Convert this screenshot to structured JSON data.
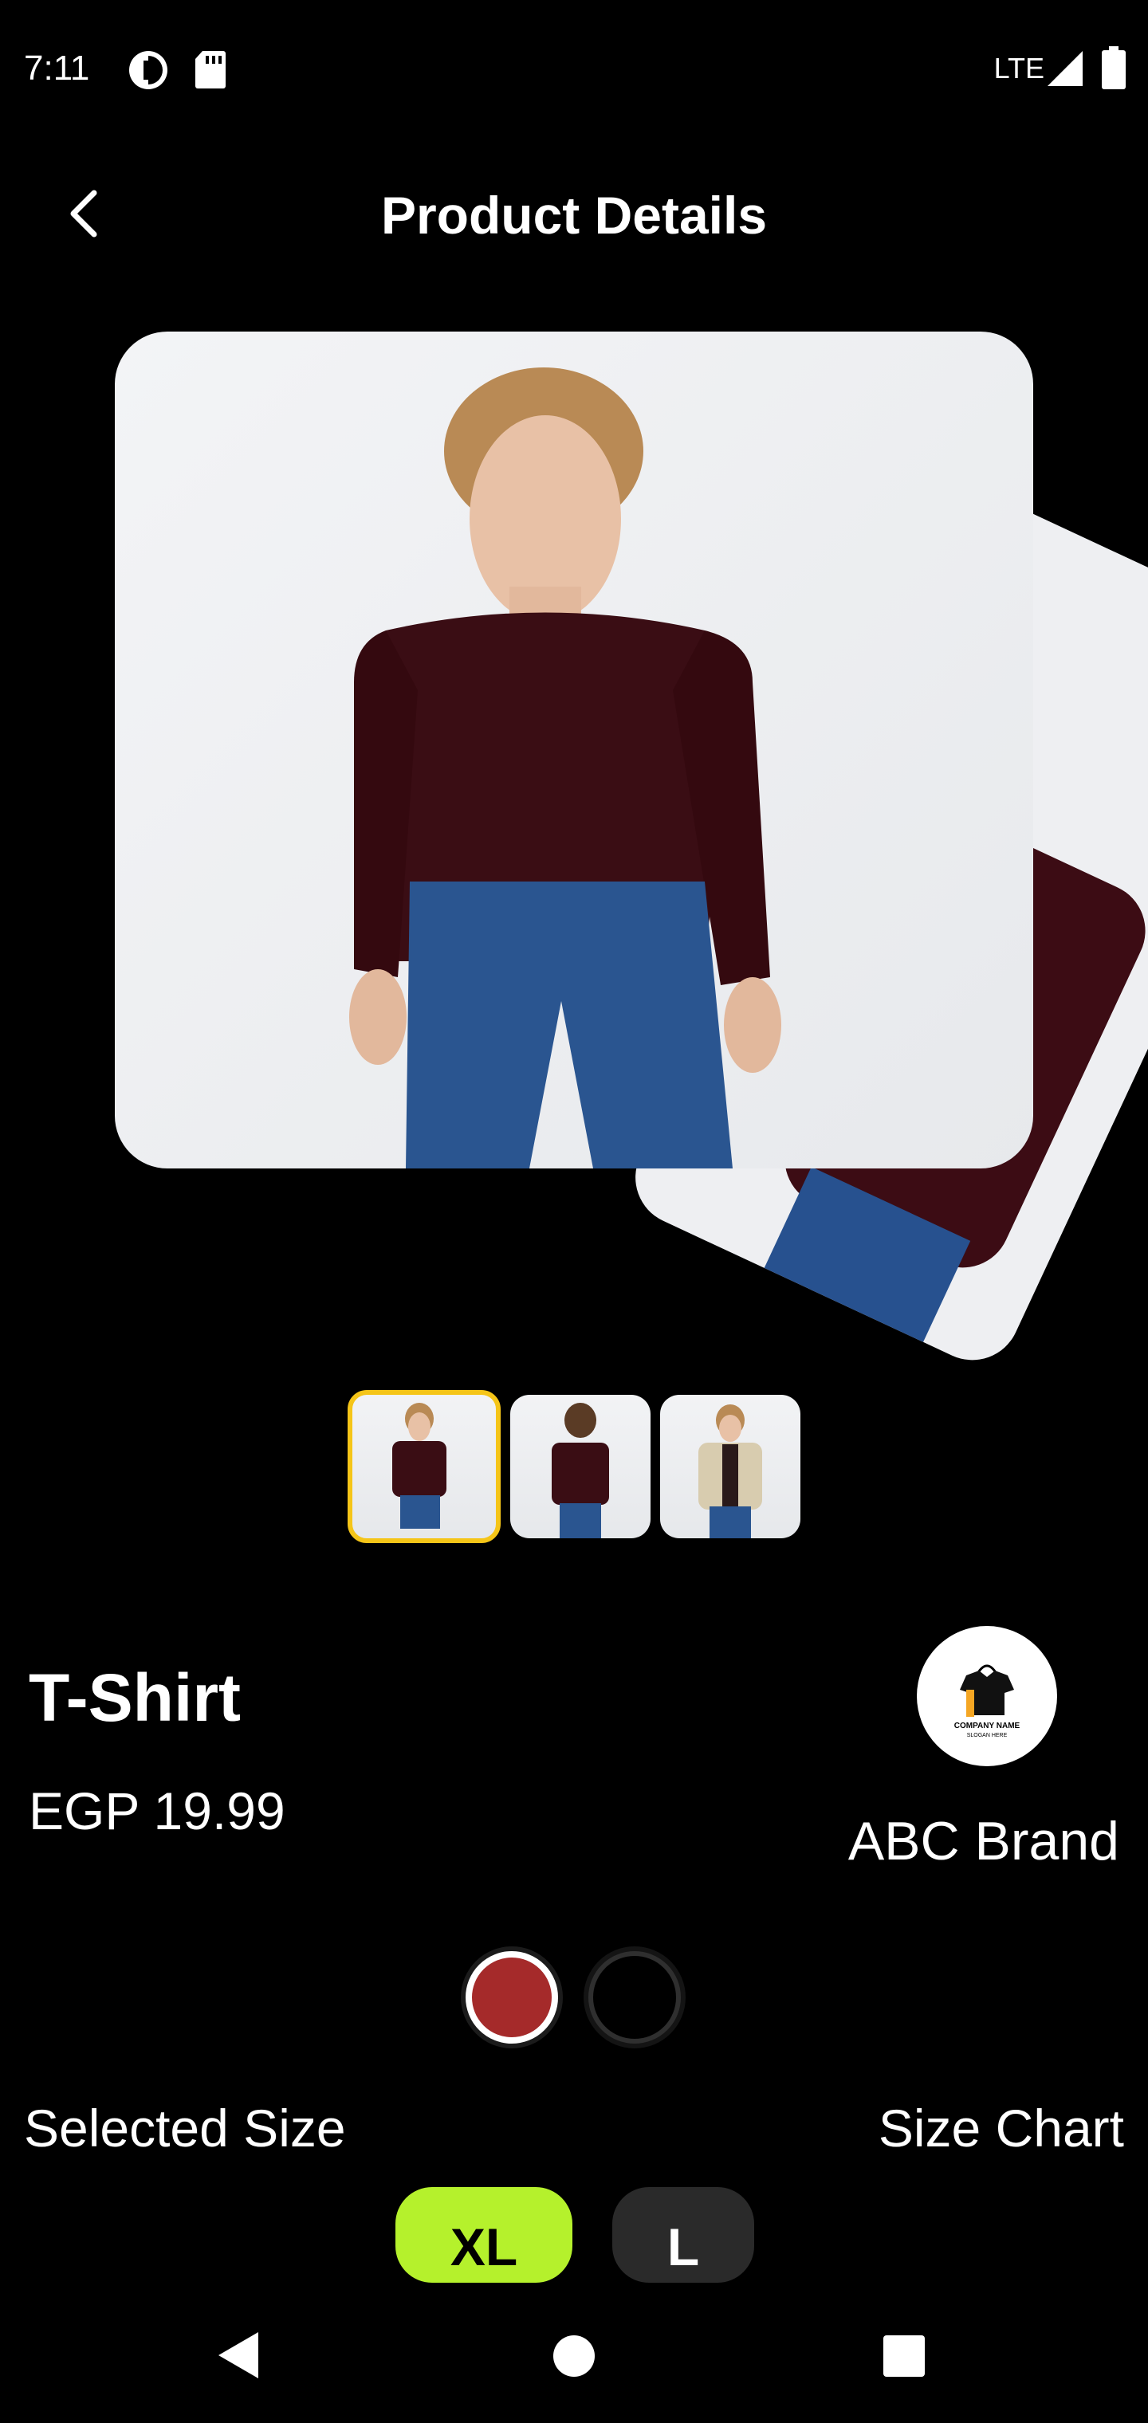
{
  "status_bar": {
    "time": "7:11",
    "network": "LTE",
    "icons": [
      "data-saver-icon",
      "sd-card-icon",
      "signal-icon",
      "battery-icon"
    ]
  },
  "header": {
    "title": "Product Details",
    "back_icon": "chevron-left-icon"
  },
  "carousel": {
    "images": [
      "model-front-burgundy-shirt",
      "model-back-burgundy-shirt",
      "model-beige-jacket"
    ],
    "active_index": 0
  },
  "thumbnails": {
    "selected_index": 0,
    "items": [
      "model-front-burgundy-shirt",
      "model-back-burgundy-shirt",
      "model-beige-jacket"
    ]
  },
  "product": {
    "name": "T-Shirt",
    "price": "EGP 19.99"
  },
  "brand": {
    "name": "ABC Brand",
    "logo_text": "COMPANY NAME",
    "logo_tagline": "SLOGAN HERE"
  },
  "colors": {
    "options": [
      "#a52a2a",
      "#000000"
    ],
    "selected_index": 0
  },
  "size": {
    "selected_label": "Selected Size",
    "chart_label": "Size Chart",
    "options": [
      "XL",
      "L"
    ],
    "selected_index": 0
  },
  "nav_bar": {
    "icons": [
      "back-triangle-icon",
      "home-circle-icon",
      "recents-square-icon"
    ]
  },
  "theme": {
    "background": "#000000",
    "accent": "#b5f12c",
    "thumb_border": "#f5c518",
    "unselected_pill": "#2a2a2a"
  }
}
